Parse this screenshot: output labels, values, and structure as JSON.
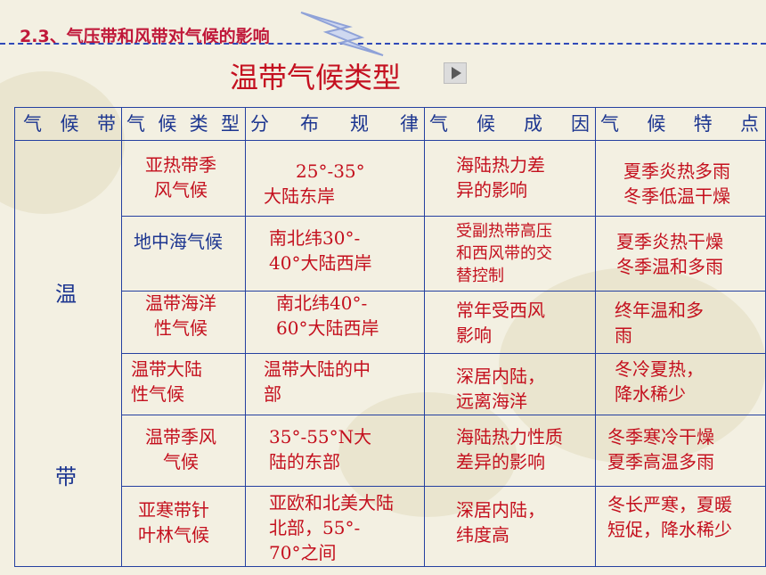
{
  "header": {
    "section_title": "2.3、气压带和风带对气候的影响"
  },
  "main_title": "温带气候类型",
  "table": {
    "columns": [
      "气 候 带",
      "气 候 类 型",
      "分 布 规 律",
      "气 候 成 因",
      "气 候 特 点"
    ],
    "zone": {
      "char1": "温",
      "char2": "带"
    },
    "rows": [
      {
        "type": [
          "亚热带季",
          "风气候"
        ],
        "distribution": [
          "25°-35°",
          "大陆东岸"
        ],
        "cause": [
          "海陆热力差",
          "异的影响"
        ],
        "feature": [
          "夏季炎热多雨",
          "冬季低温干燥"
        ]
      },
      {
        "type": [
          "地中海气候"
        ],
        "distribution": [
          "南北纬30°-",
          "40°大陆西岸"
        ],
        "cause": [
          "受副热带高压",
          "和西风带的交",
          "替控制"
        ],
        "feature": [
          "夏季炎热干燥",
          "冬季温和多雨"
        ]
      },
      {
        "type": [
          "温带海洋",
          "性气候"
        ],
        "distribution": [
          "南北纬40°-",
          "60°大陆西岸"
        ],
        "cause": [
          "常年受西风",
          "影响"
        ],
        "feature": [
          "终年温和多",
          "雨"
        ]
      },
      {
        "type": [
          "温带大陆",
          "性气候"
        ],
        "distribution": [
          "温带大陆的中",
          "部"
        ],
        "cause": [
          "深居内陆，",
          "远离海洋"
        ],
        "feature": [
          "冬冷夏热，",
          "降水稀少"
        ]
      },
      {
        "type": [
          "温带季风",
          "气候"
        ],
        "distribution": [
          "35°-55°N大",
          "陆的东部"
        ],
        "cause": [
          "海陆热力性质",
          "差异的影响"
        ],
        "feature": [
          "冬季寒冷干燥",
          "夏季高温多雨"
        ]
      },
      {
        "type": [
          "亚寒带针",
          "叶林气候"
        ],
        "distribution": [
          "亚欧和北美大陆",
          "北部，55°-",
          "70°之间"
        ],
        "cause": [
          "深居内陆，",
          "纬度高"
        ],
        "feature": [
          "冬长严寒，夏暖",
          "短促，降水稀少"
        ]
      }
    ]
  }
}
